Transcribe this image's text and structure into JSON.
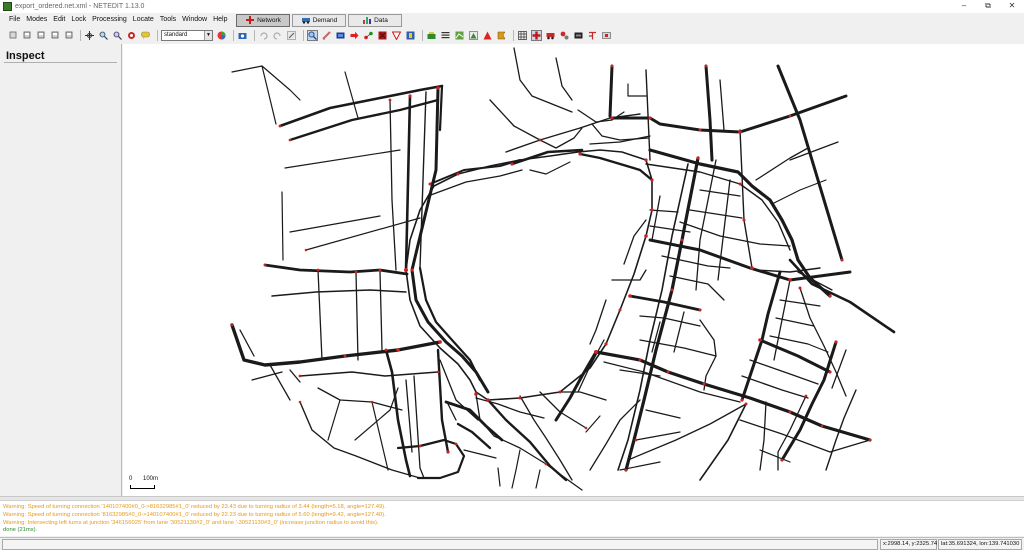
{
  "window": {
    "title": "export_ordered.net.xml - NETEDIT 1.13.0",
    "controls": [
      "minimize-icon",
      "restore-icon",
      "close-icon"
    ]
  },
  "menu": {
    "items": [
      "File",
      "Modes",
      "Edit",
      "Lock",
      "Processing",
      "Locate",
      "Tools",
      "Window",
      "Help"
    ]
  },
  "supermodes": {
    "network": "Network",
    "demand": "Demand",
    "data": "Data",
    "active": "Network"
  },
  "toolbar": {
    "view_scheme": "standard",
    "file_icons": [
      "new-network-icon",
      "open-icon",
      "save-icon",
      "save-as-icon",
      "save-all-icon"
    ],
    "view_icons": [
      "recenter-icon",
      "zoom-locate-icon",
      "locate-icon",
      "viewport-icon",
      "colorwheel-icon"
    ],
    "mode_icons": [
      "inspect-mode-icon",
      "delete-mode-icon",
      "select-mode-icon",
      "move-mode-icon",
      "edge-mode-icon",
      "connection-mode-icon",
      "prohibition-mode-icon",
      "tls-mode-icon",
      "additional-mode-icon",
      "crossing-mode-icon",
      "taz-mode-icon",
      "shape-mode-icon",
      "wire-mode-icon",
      "decal-mode-icon"
    ],
    "option_icons": [
      "grid-icon",
      "junction-shape-icon",
      "vehicle-spread-icon",
      "show-connections-icon",
      "hide-connections-icon",
      "color-edges-icon",
      "merge-junctions-icon"
    ]
  },
  "inspect": {
    "title": "Inspect"
  },
  "canvas": {
    "scale_zero": "0",
    "scale_length": "100m",
    "road_color": "#1a1a1a",
    "junction_color": "#cc2222"
  },
  "messages": [
    {
      "level": "warn",
      "text": "Warning: Speed of turning connection '140107400#0_0->81632985#1_0' reduced by 23.43 due to turning radius of 3.44 (length=5.18, angle=127.49)."
    },
    {
      "level": "warn",
      "text": "Warning: Speed of turning connection '81632985#0_0->140107400#1_0' reduced by 22.23 due to turning radius of 5.60 (length=9.42, angle=127.40)."
    },
    {
      "level": "warn",
      "text": "Warning: Intersecting left turns at junction '346156025' from lane '30521130#2_0' and lane '-30521130#3_0' (increase junction radius to avoid this)."
    },
    {
      "level": "ok",
      "text": "done (21ms)."
    }
  ],
  "status": {
    "main": "",
    "xy": "x:2998.14, y:2325.74",
    "latlon": "lat:35.691324, lon:139.741030"
  }
}
